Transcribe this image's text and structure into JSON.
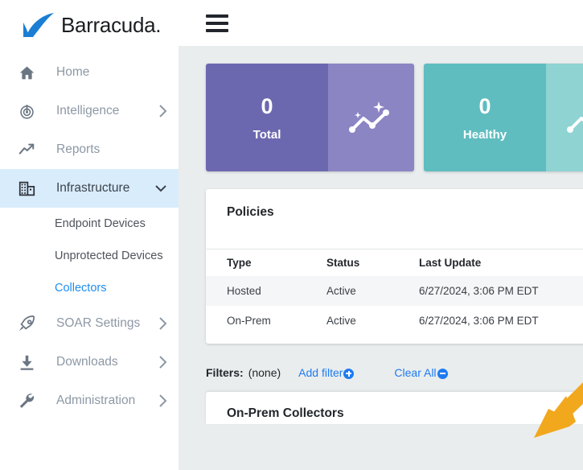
{
  "brand": {
    "name": "Barracuda",
    "logo_icon": "barracuda-fin-logo",
    "accent_blue": "#1e7bf0",
    "logo_blue": "#1a7ed4"
  },
  "topbar": {
    "menu_icon": "hamburger-menu-icon"
  },
  "sidebar": {
    "items": [
      {
        "label": "Home",
        "icon": "home-icon",
        "chevron": "",
        "active": false
      },
      {
        "label": "Intelligence",
        "icon": "radar-icon",
        "chevron": "›",
        "active": false
      },
      {
        "label": "Reports",
        "icon": "trend-up-icon",
        "chevron": "",
        "active": false
      },
      {
        "label": "Infrastructure",
        "icon": "building-icon",
        "chevron": "⌄",
        "active": true
      },
      {
        "label": "SOAR Settings",
        "icon": "rocket-icon",
        "chevron": "›",
        "active": false
      },
      {
        "label": "Downloads",
        "icon": "download-icon",
        "chevron": "›",
        "active": false
      },
      {
        "label": "Administration",
        "icon": "wrench-icon",
        "chevron": "›",
        "active": false
      }
    ],
    "subitems": [
      {
        "label": "Endpoint Devices",
        "selected": false
      },
      {
        "label": "Unprotected Devices",
        "selected": false
      },
      {
        "label": "Collectors",
        "selected": true
      }
    ]
  },
  "stats": [
    {
      "value": "0",
      "label": "Total",
      "icon": "sparkline-chart-icon",
      "color_main": "#6c68b0",
      "color_icon": "#8b85c4"
    },
    {
      "value": "0",
      "label": "Healthy",
      "icon": "sparkline-chart-icon",
      "color_main": "#5fbdbf",
      "color_icon": "#8fd3d3"
    }
  ],
  "policies": {
    "title": "Policies",
    "columns": [
      "Type",
      "Status",
      "Last Update"
    ],
    "rows": [
      {
        "type": "Hosted",
        "status": "Active",
        "last_update": "6/27/2024, 3:06 PM EDT"
      },
      {
        "type": "On-Prem",
        "status": "Active",
        "last_update": "6/27/2024, 3:06 PM EDT"
      }
    ]
  },
  "filters": {
    "label": "Filters:",
    "value": "(none)",
    "add_label": "Add filter",
    "clear_label": "Clear All",
    "add_icon": "circle-plus-icon",
    "clear_icon": "circle-minus-icon"
  },
  "bottom_panel": {
    "title": "On-Prem Collectors"
  },
  "annotation": {
    "arrow_icon": "orange-pointer-arrow",
    "color": "#f2a81d",
    "points_to": "Add filter"
  }
}
